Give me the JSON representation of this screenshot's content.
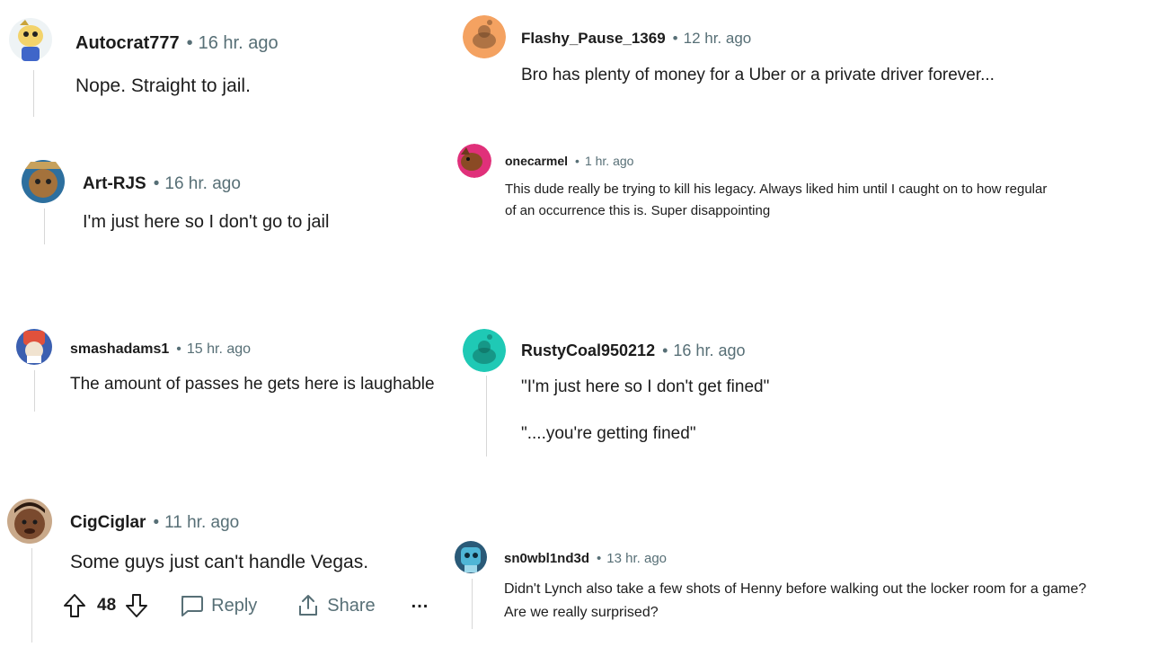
{
  "comments": [
    {
      "author": "Autocrat777",
      "time": "16 hr. ago",
      "lines": [
        "Nope. Straight to jail."
      ]
    },
    {
      "author": "Art-RJS",
      "time": "16 hr. ago",
      "lines": [
        "I'm just here so I don't go to jail"
      ]
    },
    {
      "author": "smashadams1",
      "time": "15 hr. ago",
      "lines": [
        "The amount of passes he gets here is laughable"
      ]
    },
    {
      "author": "CigCiglar",
      "time": "11 hr. ago",
      "lines": [
        "Some guys just can't handle Vegas."
      ]
    },
    {
      "author": "Flashy_Pause_1369",
      "time": "12 hr. ago",
      "lines": [
        "Bro has plenty of money for a Uber or a private driver forever..."
      ]
    },
    {
      "author": "onecarmel",
      "time": "1 hr. ago",
      "lines": [
        "This dude really be trying to kill his legacy. Always liked him until I caught on to how regular",
        "of an occurrence this is. Super disappointing"
      ]
    },
    {
      "author": "RustyCoal950212",
      "time": "16 hr. ago",
      "lines": [
        "\"I'm just here so I don't get fined\"",
        "\"....you're getting fined\""
      ]
    },
    {
      "author": "sn0wbl1nd3d",
      "time": "13 hr. ago",
      "lines": [
        "Didn't Lynch also take a few shots of Henny before walking out the locker room for a game?",
        "Are we really surprised?"
      ]
    }
  ],
  "actions": {
    "vote_count": "48",
    "reply_label": "Reply",
    "share_label": "Share",
    "more_label": "..."
  },
  "icons": {
    "upvote": "upvote-icon",
    "downvote": "downvote-icon",
    "reply": "chat-bubble-icon",
    "share": "share-icon",
    "more": "more-icon"
  },
  "colors": {
    "meta_gray": "#576f76",
    "text": "#1c1c1c",
    "thread_line": "#d7d7d7",
    "snoo_orange": "#f4a261",
    "snoo_teal": "#1fc9b5"
  }
}
